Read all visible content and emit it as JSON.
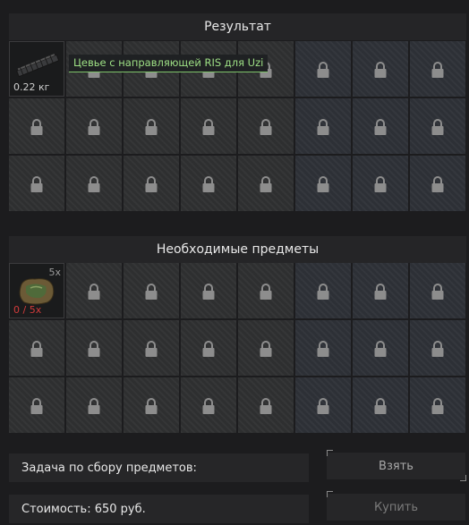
{
  "result": {
    "title": "Результат",
    "item": {
      "icon": "rail-handguard-icon",
      "weight": "0.22 кг",
      "tooltip": "Цевье с направляющей RIS для Uzi"
    }
  },
  "required": {
    "title": "Необходимые предметы",
    "item": {
      "icon": "material-bag-icon",
      "count": "5x",
      "progress": "0 / 5x"
    }
  },
  "footer": {
    "task_label": "Задача по сбору предметов:",
    "cost_label": "Стоимость: 650  руб.",
    "take_button": "Взять",
    "buy_button": "Купить"
  },
  "colors": {
    "tooltip_text": "#9ee085",
    "progress_text": "#d23b3b",
    "panel_bg": "#1c1c1e"
  }
}
